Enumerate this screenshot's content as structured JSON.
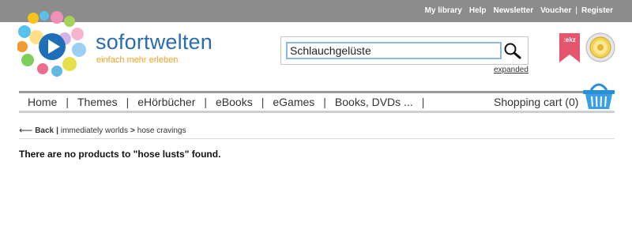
{
  "top_links": {
    "my_library": "My library",
    "help": "Help",
    "newsletter": "Newsletter",
    "voucher": "Voucher",
    "separator": "|",
    "register": "Register"
  },
  "brand": {
    "name": "sofortwelten",
    "tagline": "einfach mehr erleben"
  },
  "search": {
    "value": "Schlauchgelüste",
    "expanded_link": "expanded"
  },
  "nav": {
    "items": [
      "Home",
      "Themes",
      "eHörbücher",
      "eBooks",
      "eGames",
      "Books, DVDs ..."
    ],
    "separator": "|",
    "cart_label": "Shopping cart (0)"
  },
  "breadcrumb": {
    "back": "Back",
    "separator": "|",
    "level1": "immediately worlds",
    "arrow": ">",
    "level2": "hose cravings"
  },
  "message": "There are no products to \"hose lusts\" found.",
  "badges": {
    "ekz_text": ":ekz"
  },
  "colors": {
    "topbar": "#8c8c8c",
    "brand_blue": "#2a6cb0",
    "tagline_orange": "#f4a21d",
    "ekz_pink": "#e4556e",
    "cart_blue": "#2b8fd6"
  },
  "icons": [
    "play-icon",
    "search-icon",
    "ekz-bookmark-icon",
    "trusted-shops-seal-icon",
    "shopping-basket-icon",
    "back-arrow-icon"
  ]
}
